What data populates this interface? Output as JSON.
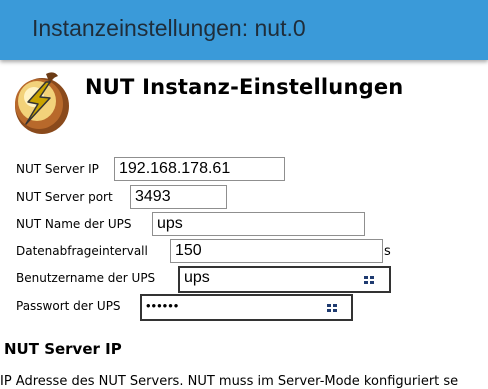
{
  "window": {
    "title": "Instanzeinstellungen: nut.0"
  },
  "page": {
    "heading": "NUT Instanz-Einstellungen"
  },
  "fields": {
    "server_ip": {
      "label": "NUT Server IP",
      "value": "192.168.178.61"
    },
    "server_port": {
      "label": "NUT Server port",
      "value": "3493"
    },
    "ups_name": {
      "label": "NUT Name der UPS",
      "value": "ups"
    },
    "interval": {
      "label": "Datenabfrageintervall",
      "value": "150",
      "suffix": "s"
    },
    "username": {
      "label": "Benutzername der UPS",
      "value": "ups"
    },
    "password": {
      "label": "Passwort der UPS",
      "value": "••••••"
    }
  },
  "help": {
    "title": "NUT Server IP",
    "text": "IP Adresse des NUT Servers. NUT muss im Server-Mode konfiguriert se"
  },
  "colors": {
    "titlebar": "#3a9ad9"
  },
  "icons": {
    "logo": "nut-lightning-logo",
    "field": "password-manager-icon"
  }
}
